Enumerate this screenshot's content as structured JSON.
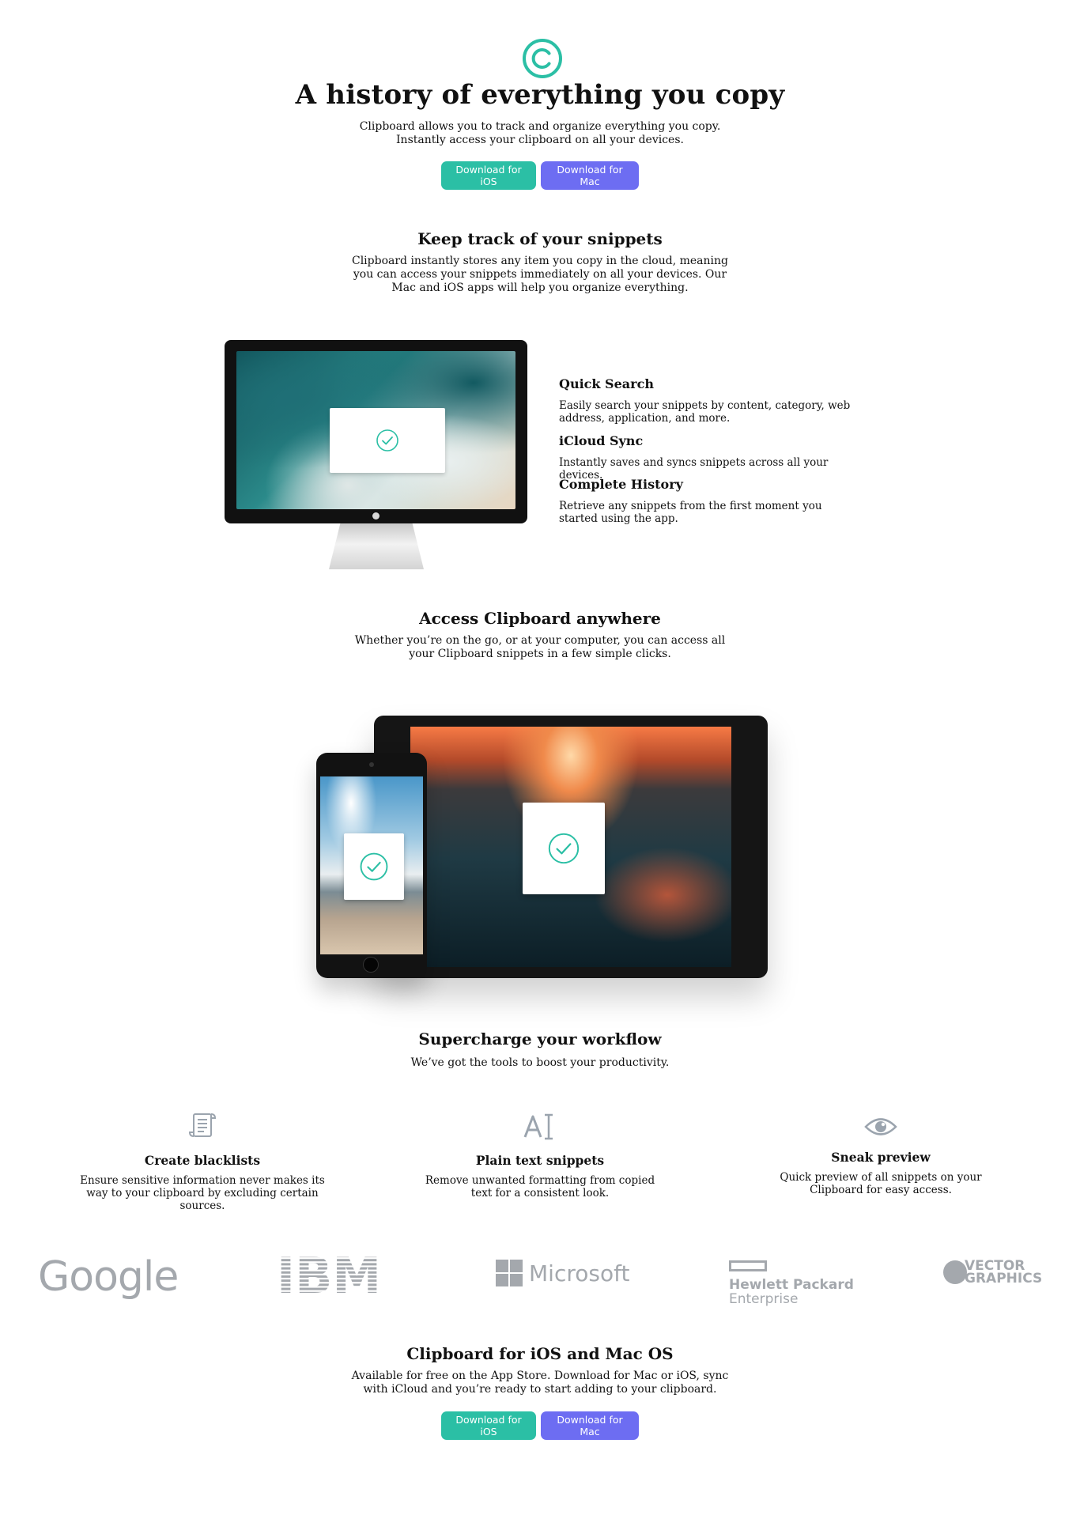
{
  "hero": {
    "title": "A history of everything you copy",
    "lead": "Clipboard allows you to track and organize everything you copy. Instantly access your clipboard on all your devices.",
    "btn_ios": "Download for iOS",
    "btn_mac": "Download for Mac"
  },
  "snippets": {
    "title": "Keep track of your snippets",
    "lead": "Clipboard instantly stores any item you copy in the cloud, meaning you can access your snippets immediately on all your devices. Our Mac and iOS apps will help you organize everything."
  },
  "features": [
    {
      "title": "Quick Search",
      "text": "Easily search your snippets by content, category, web address, application, and more."
    },
    {
      "title": "iCloud Sync",
      "text": "Instantly saves and syncs snippets across all your devices."
    },
    {
      "title": "Complete History",
      "text": "Retrieve any snippets from the first moment you started using the app."
    }
  ],
  "anywhere": {
    "title": "Access Clipboard anywhere",
    "lead": "Whether you’re on the go, or at your computer, you can access all your Clipboard snippets in a few simple clicks."
  },
  "workflow": {
    "title": "Supercharge your workflow",
    "lead": "We’ve got the tools to boost your productivity."
  },
  "tools": [
    {
      "icon": "blacklist-icon",
      "title": "Create blacklists",
      "text": "Ensure sensitive information never makes its way to your clipboard by excluding certain sources."
    },
    {
      "icon": "text-cursor-icon",
      "title": "Plain text snippets",
      "text": "Remove unwanted formatting from copied text for a consistent look."
    },
    {
      "icon": "eye-icon",
      "title": "Sneak preview",
      "text": "Quick preview of all snippets on your Clipboard for easy access."
    }
  ],
  "logos": {
    "google": "Google",
    "ibm": "IBM",
    "microsoft": "Microsoft",
    "hp_line1": "Hewlett Packard",
    "hp_line2": "Enterprise",
    "vector_line1": "VECTOR",
    "vector_line2": "GRAPHICS"
  },
  "cta": {
    "title": "Clipboard for iOS and Mac OS",
    "lead": "Available for free on the App Store. Download for Mac or iOS, sync with iCloud and you’re ready to start adding to your clipboard.",
    "btn_ios": "Download for iOS",
    "btn_mac": "Download for Mac"
  },
  "colors": {
    "accent_teal": "#2bbfa5",
    "accent_purple": "#6d6df2",
    "logo_gray": "#a4a8ad",
    "icon_gray": "#9ba4ae"
  }
}
